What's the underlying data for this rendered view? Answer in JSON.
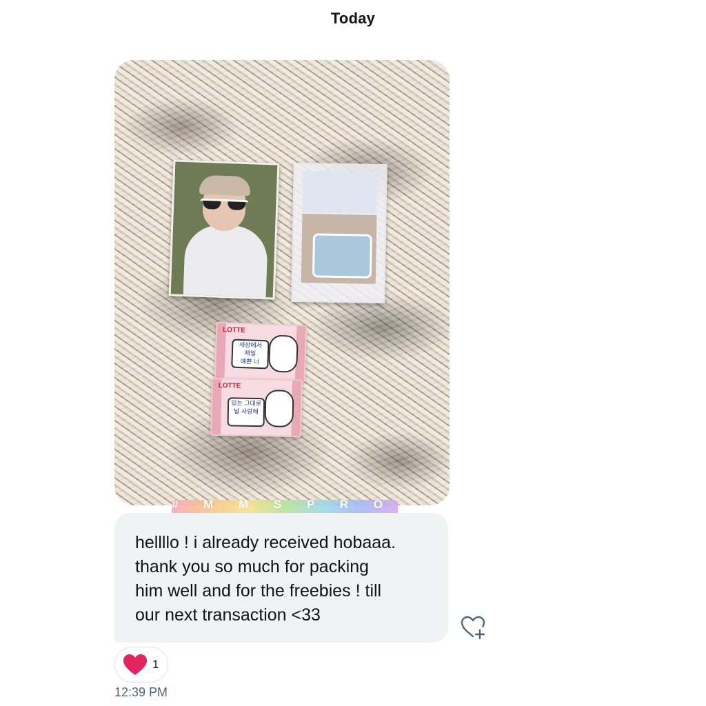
{
  "conversation": {
    "date_header": "Today"
  },
  "photo": {
    "watermark": "# M M S P R O O F S",
    "snack_brand": "LOTTE",
    "snack1_text": "세상에서\n제일\n예쁜 너",
    "snack2_text": "있는 그대로\n널 사랑해"
  },
  "message": {
    "text": "hellllo ! i already received hobaaa.\nthank you so much for packing\nhim well and for the freebies ! till\nour next transaction <33",
    "timestamp": "12:39 PM"
  },
  "reaction": {
    "emoji_icon": "heart-icon",
    "count": "1",
    "color": "#e0245e"
  },
  "actions": {
    "add_reaction_icon": "heart-plus-icon"
  }
}
